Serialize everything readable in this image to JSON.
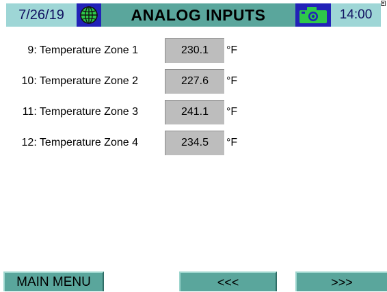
{
  "header": {
    "date": "7/26/19",
    "title": "ANALOG INPUTS",
    "time": "14:00",
    "globe_icon": "globe-icon",
    "camera_icon": "camera-icon"
  },
  "colors": {
    "header_light": "#9ed6d6",
    "header_teal": "#5aa69c",
    "icon_blue": "#2222b8",
    "value_gray": "#bdbdbd"
  },
  "inputs": [
    {
      "label": "9: Temperature Zone 1",
      "value": "230.1",
      "unit": "°F"
    },
    {
      "label": "10: Temperature Zone 2",
      "value": "227.6",
      "unit": "°F"
    },
    {
      "label": "11: Temperature Zone 3",
      "value": "241.1",
      "unit": "°F"
    },
    {
      "label": "12: Temperature Zone 4",
      "value": "234.5",
      "unit": "°F"
    }
  ],
  "footer": {
    "main_menu": "MAIN MENU",
    "prev": "<<<",
    "next": ">>>"
  }
}
